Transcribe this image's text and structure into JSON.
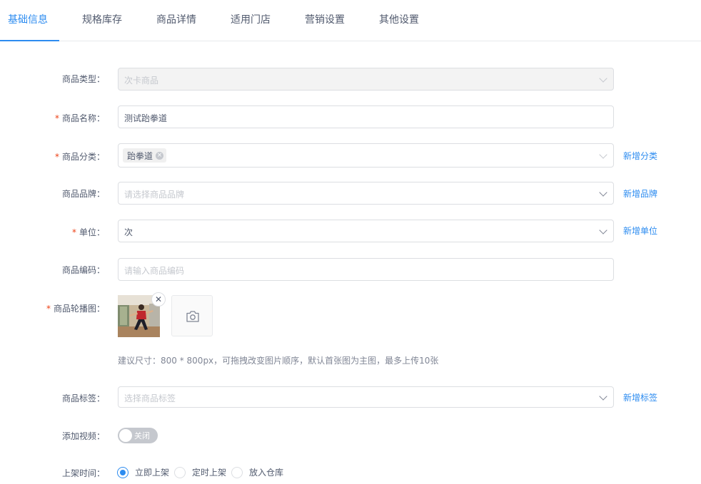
{
  "tabs": [
    "基础信息",
    "规格库存",
    "商品详情",
    "适用门店",
    "营销设置",
    "其他设置"
  ],
  "form": {
    "type": {
      "label": "商品类型：",
      "value": "次卡商品"
    },
    "name": {
      "label": "商品名称：",
      "value": "测试跆拳道"
    },
    "category": {
      "label": "商品分类：",
      "tag": "跆拳道",
      "link": "新增分类"
    },
    "brand": {
      "label": "商品品牌：",
      "placeholder": "请选择商品品牌",
      "link": "新增品牌"
    },
    "unit": {
      "label": "单位：",
      "value": "次",
      "link": "新增单位"
    },
    "code": {
      "label": "商品编码：",
      "placeholder": "请输入商品编码"
    },
    "carousel": {
      "label": "商品轮播图：",
      "hint": "建议尺寸：800 * 800px，可拖拽改变图片顺序，默认首张图为主图，最多上传10张"
    },
    "tags": {
      "label": "商品标签：",
      "placeholder": "选择商品标签",
      "link": "新增标签"
    },
    "video": {
      "label": "添加视频：",
      "switch_text": "关闭"
    },
    "shelf": {
      "label": "上架时间：",
      "options": [
        "立即上架",
        "定时上架",
        "放入仓库"
      ],
      "selected": "立即上架"
    }
  },
  "required_mark": "*",
  "colors": {
    "primary": "#2d8cf0",
    "required": "#ed4014",
    "border": "#dcdee2"
  },
  "icons": {
    "tag_close": "close-circle-icon",
    "remove_image": "close-icon",
    "upload": "camera-icon",
    "dropdown": "chevron-down-icon"
  }
}
